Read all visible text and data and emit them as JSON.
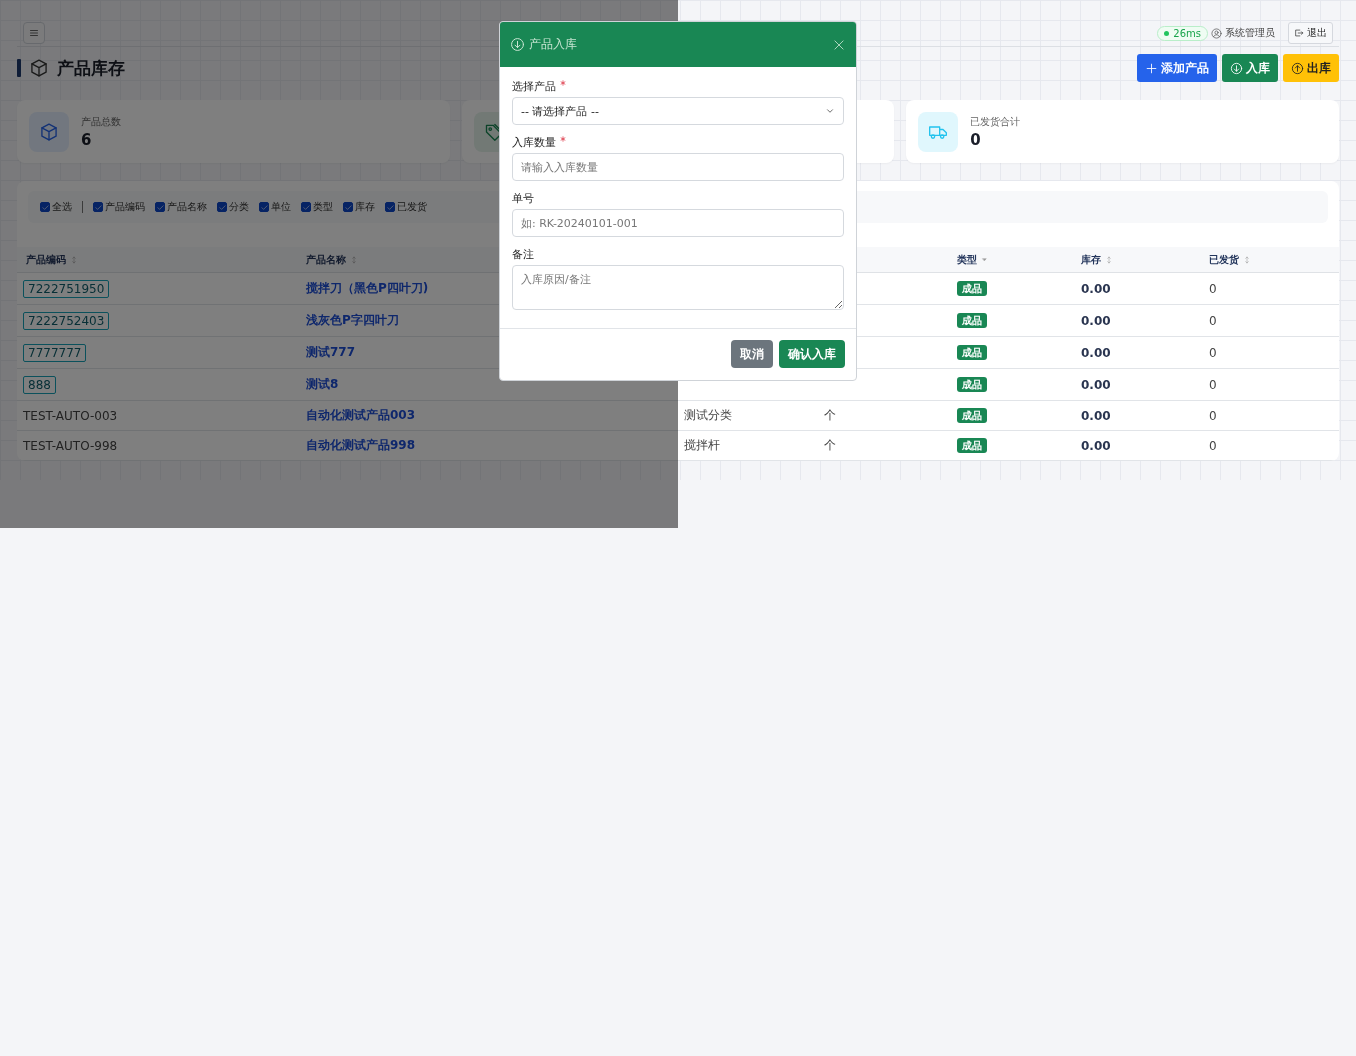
{
  "topbar": {
    "latency": "26ms",
    "user": "系统管理员",
    "logout": "退出"
  },
  "page": {
    "title": "产品库存",
    "actions": [
      {
        "kind": "add",
        "label": "添加产品"
      },
      {
        "kind": "in",
        "label": "入库"
      },
      {
        "kind": "out",
        "label": "出库"
      }
    ]
  },
  "stats": [
    {
      "kind": "box",
      "label": "产品总数",
      "value": "6"
    },
    {
      "kind": "tag"
    },
    {
      "kind": "truck",
      "label": "已发货合计",
      "value": "0"
    }
  ],
  "column_toggles": [
    {
      "label": "全选",
      "checked": true
    },
    {
      "label": "产品编码",
      "checked": true
    },
    {
      "label": "产品名称",
      "checked": true
    },
    {
      "label": "分类",
      "checked": true
    },
    {
      "label": "单位",
      "checked": true
    },
    {
      "label": "类型",
      "checked": true
    },
    {
      "label": "库存",
      "checked": true
    },
    {
      "label": "已发货",
      "checked": true
    }
  ],
  "table": {
    "columns": [
      {
        "label": "产品编码",
        "kind": "sortable"
      },
      {
        "label": "产品名称",
        "kind": "sortable"
      },
      {},
      {},
      {
        "label": "类型",
        "kind": "filter"
      },
      {
        "label": "库存",
        "kind": "sortable"
      },
      {
        "label": "已发货",
        "kind": "sortable"
      }
    ],
    "rows": [
      {
        "code": "7222751950",
        "code_tagged": true,
        "name": "搅拌刀（黑色P四叶刀)",
        "type": "成品",
        "stock": "0.00",
        "shipped": "0"
      },
      {
        "code": "7222752403",
        "code_tagged": true,
        "name": "浅灰色P字四叶刀",
        "type": "成品",
        "stock": "0.00",
        "shipped": "0"
      },
      {
        "code": "7777777",
        "code_tagged": true,
        "name": "测试777",
        "type": "成品",
        "stock": "0.00",
        "shipped": "0"
      },
      {
        "code": "888",
        "code_tagged": true,
        "name": "测试8",
        "type": "成品",
        "stock": "0.00",
        "shipped": "0"
      },
      {
        "code": "TEST-AUTO-003",
        "code_tagged": false,
        "name": "自动化测试产品003",
        "category": "测试分类",
        "unit": "个",
        "type": "成品",
        "stock": "0.00",
        "shipped": "0"
      },
      {
        "code": "TEST-AUTO-998",
        "code_tagged": false,
        "name": "自动化测试产品998",
        "category": "搅拌杆",
        "unit": "个",
        "type": "成品",
        "stock": "0.00",
        "shipped": "0"
      }
    ]
  },
  "modal": {
    "title": "产品入库",
    "fields": [
      {
        "kind": "select",
        "label": "选择产品",
        "required": true,
        "value": "-- 请选择产品 --"
      },
      {
        "kind": "input",
        "label": "入库数量",
        "required": true,
        "placeholder": "请输入入库数量"
      },
      {
        "kind": "input",
        "label": "单号",
        "required": false,
        "placeholder": "如: RK-20240101-001"
      },
      {
        "kind": "textarea",
        "label": "备注",
        "required": false,
        "placeholder": "入库原因/备注"
      }
    ],
    "buttons": [
      {
        "kind": "secondary",
        "label": "取消"
      },
      {
        "kind": "primary",
        "label": "确认入库"
      }
    ]
  }
}
